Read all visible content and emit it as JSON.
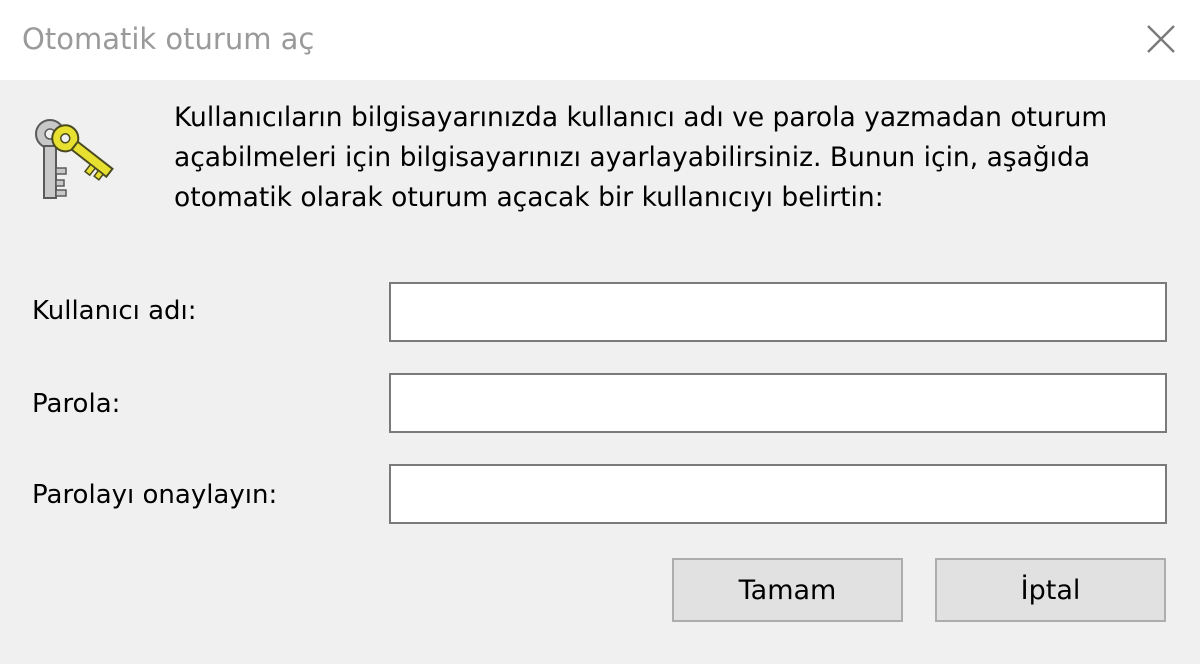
{
  "window": {
    "title": "Otomatik oturum aç"
  },
  "description": "Kullanıcıların bilgisayarınızda kullanıcı adı ve parola yazmadan oturum açabilmeleri için bilgisayarınızı ayarlayabilirsiniz. Bunun için, aşağıda otomatik olarak oturum açacak bir kullanıcıyı belirtin:",
  "icons": {
    "header": "keys-icon",
    "close": "close-icon"
  },
  "form": {
    "username": {
      "label": "Kullanıcı adı:",
      "value": ""
    },
    "password": {
      "label": "Parola:",
      "value": ""
    },
    "confirm_password": {
      "label": "Parolayı onaylayın:",
      "value": ""
    }
  },
  "buttons": {
    "ok": "Tamam",
    "cancel": "İptal"
  },
  "colors": {
    "title_text": "#9a9a9a",
    "dialog_background": "#f0f0f0",
    "button_background": "#e1e1e1",
    "key_gold": "#e8e030"
  }
}
